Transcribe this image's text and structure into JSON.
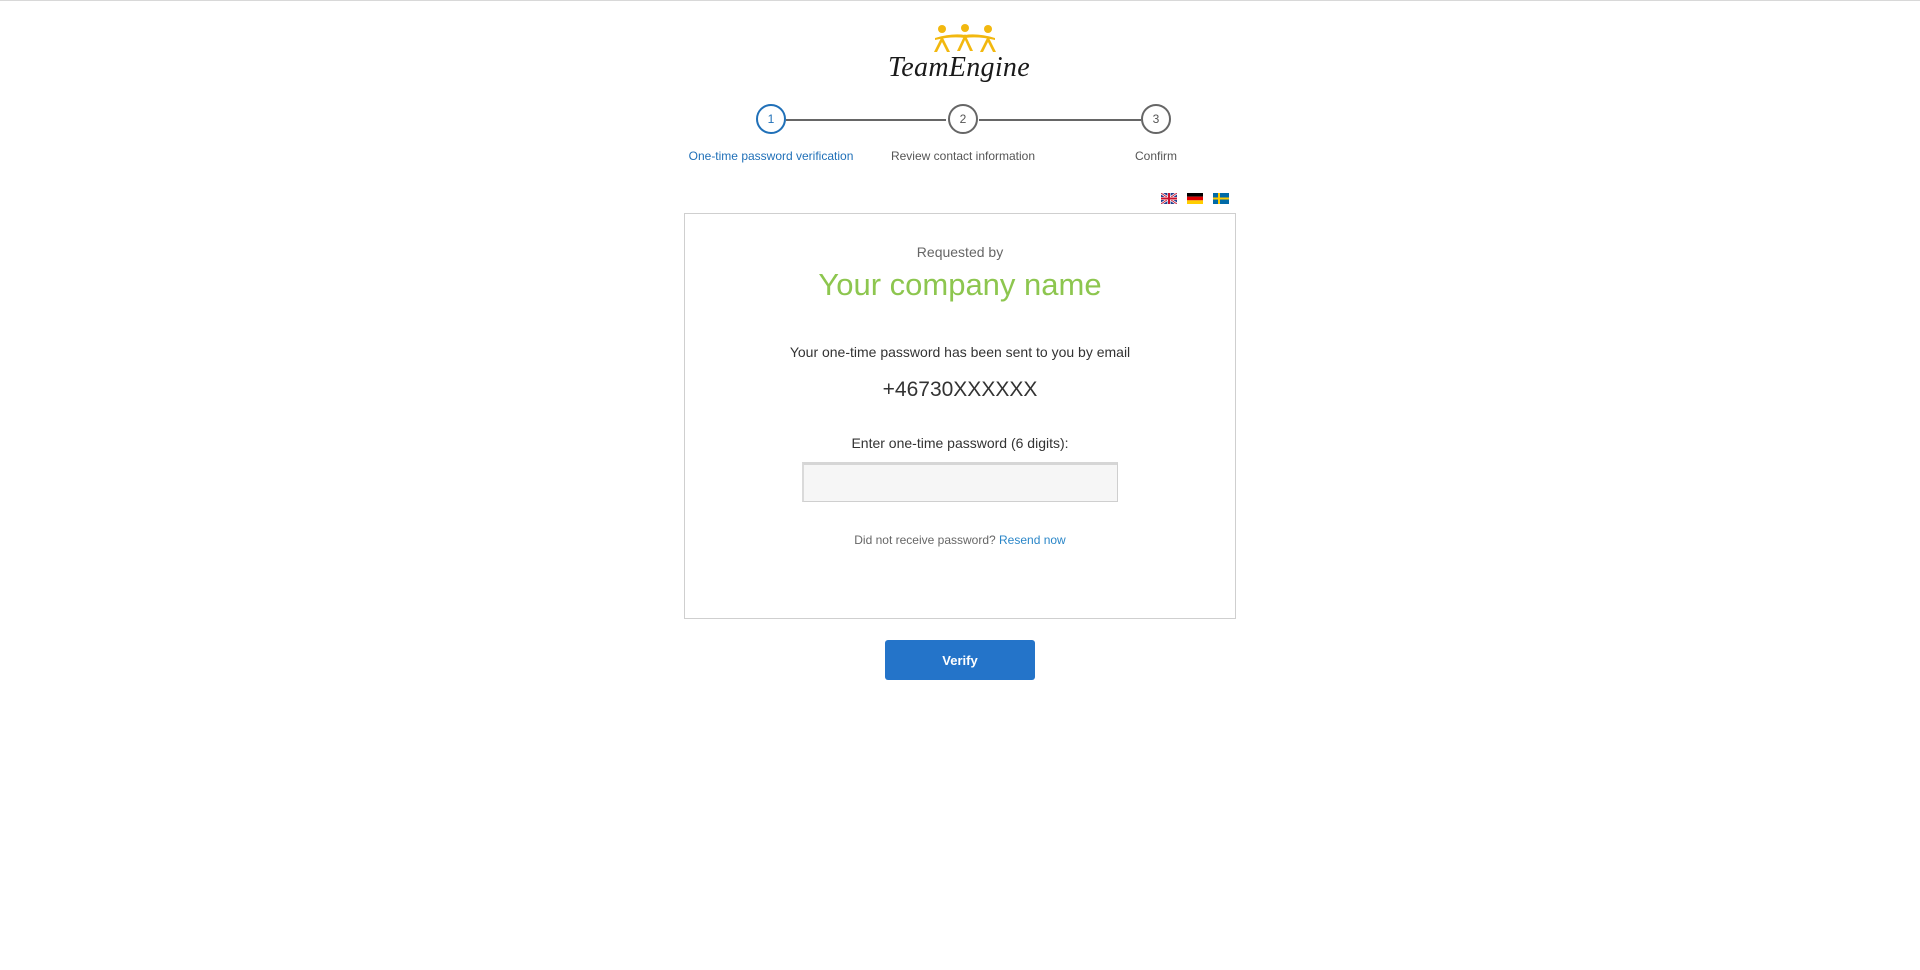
{
  "brand": {
    "logo_text": "TeamEngine",
    "logo_color": "#f2b80f",
    "icon": "people-logo-icon"
  },
  "stepper": {
    "steps": [
      {
        "number": "1",
        "label": "One-time password verification",
        "active": true
      },
      {
        "number": "2",
        "label": "Review contact information",
        "active": false
      },
      {
        "number": "3",
        "label": "Confirm",
        "active": false
      }
    ],
    "active_color": "#2070b8"
  },
  "languages": [
    {
      "icon": "uk-flag-icon",
      "name": "English"
    },
    {
      "icon": "german-flag-icon",
      "name": "German"
    },
    {
      "icon": "swedish-flag-icon",
      "name": "Swedish"
    }
  ],
  "card": {
    "requested_by": "Requested by",
    "company_name": "Your company name",
    "company_color": "#8dc64f",
    "sent_text": "Your one-time password has been sent to you by email",
    "phone": "+46730XXXXXX",
    "enter_label": "Enter one-time password (6 digits):",
    "otp_value": "",
    "resend_prompt": "Did not receive password?",
    "resend_link": "Resend now"
  },
  "actions": {
    "verify_label": "Verify",
    "verify_color": "#2474c9"
  }
}
